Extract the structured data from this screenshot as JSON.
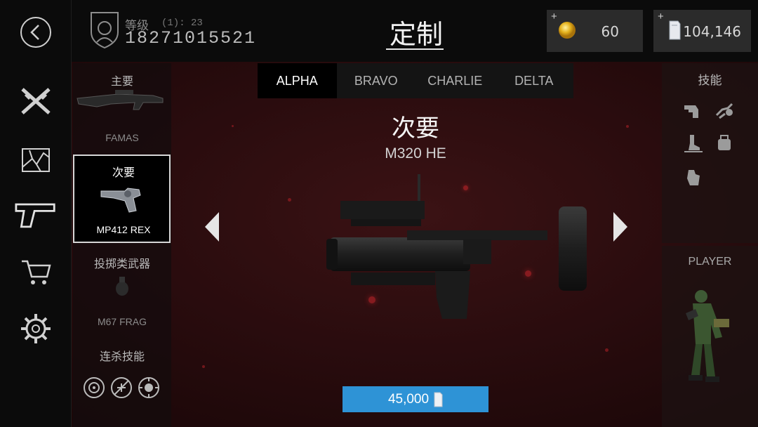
{
  "header": {
    "rank_label": "等级",
    "rank_value": "(1): 23",
    "player_id": "18271015521",
    "title": "定制"
  },
  "currency": {
    "coins": {
      "plus": "+",
      "value": "60",
      "icon": "gold-coin-icon"
    },
    "premium": {
      "plus": "+",
      "value": "104,146",
      "icon": "silver-bar-icon"
    }
  },
  "left_nav": [
    "back-icon",
    "crossed-rifles-icon",
    "broken-glass-icon",
    "pistol-icon",
    "shopping-cart-icon",
    "gear-icon"
  ],
  "loadout": {
    "primary": {
      "title": "主要",
      "name": "FAMAS"
    },
    "secondary": {
      "title": "次要",
      "name": "MP412 REX"
    },
    "throwable": {
      "title": "投掷类武器",
      "name": "M67 FRAG"
    },
    "killstreak": {
      "title": "连杀技能",
      "icons": [
        "streak-radar-icon",
        "streak-nofly-icon",
        "streak-compass-icon"
      ]
    }
  },
  "tabs": [
    {
      "label": "ALPHA",
      "active": true
    },
    {
      "label": "BRAVO",
      "active": false
    },
    {
      "label": "CHARLIE",
      "active": false
    },
    {
      "label": "DELTA",
      "active": false
    }
  ],
  "weapon": {
    "slot_title": "次要",
    "name": "M320 HE",
    "price": "45,000"
  },
  "skills": {
    "title": "技能",
    "icons": [
      "hand-icon",
      "grenade-throw-icon",
      "boot-icon",
      "backpack-icon",
      "glove-icon"
    ]
  },
  "player": {
    "label": "PLAYER"
  },
  "colors": {
    "accent": "#2e93d6",
    "background": "#2a0c0e",
    "panel": "#0b0b0b"
  }
}
